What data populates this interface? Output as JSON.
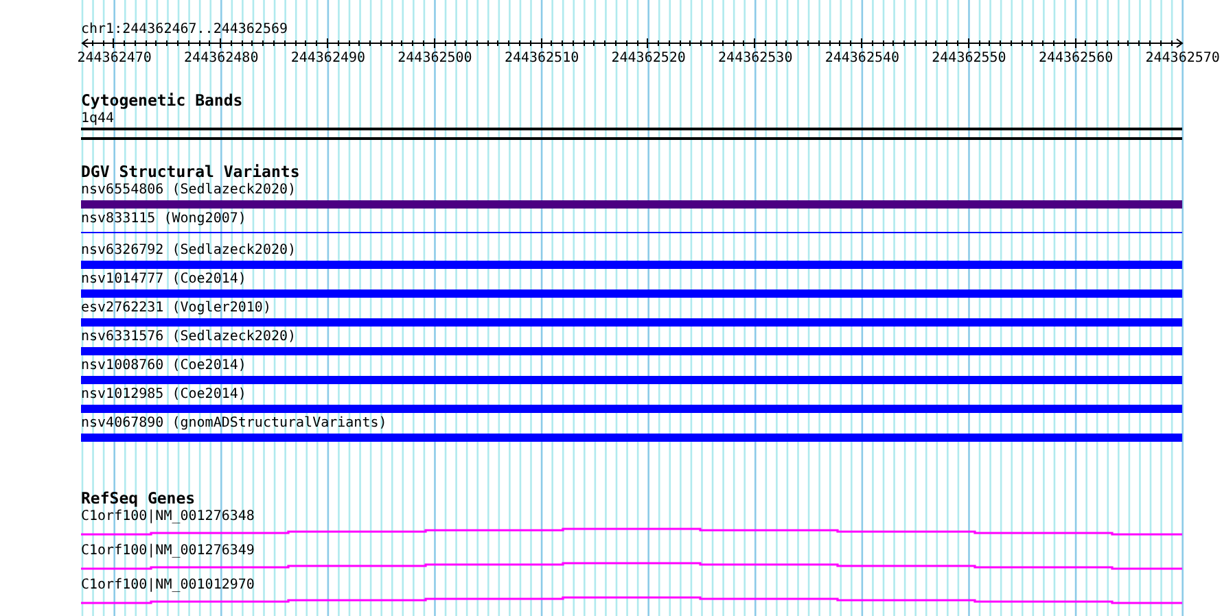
{
  "ruler": {
    "title": "chr1:244362467..244362569",
    "labels": [
      "244362470",
      "244362480",
      "244362490",
      "244362500",
      "244362510",
      "244362520",
      "244362530",
      "244362540",
      "244362550",
      "244362560",
      "244362570"
    ]
  },
  "tracks": [
    {
      "kind": "bands",
      "title": "Cytogenetic Bands",
      "features": [
        {
          "label": "1q44"
        }
      ]
    },
    {
      "kind": "variants",
      "title": "DGV Structural Variants",
      "features": [
        {
          "label": "nsv6554806 (Sedlazeck2020)",
          "kind": "thick",
          "color": "#4b0082"
        },
        {
          "label": "nsv833115 (Wong2007)",
          "kind": "thin",
          "color": "#0000ff"
        },
        {
          "label": "nsv6326792 (Sedlazeck2020)",
          "kind": "thick",
          "color": "#0000ff"
        },
        {
          "label": "nsv1014777 (Coe2014)",
          "kind": "thick",
          "color": "#0000ff"
        },
        {
          "label": "esv2762231 (Vogler2010)",
          "kind": "thick",
          "color": "#0000ff"
        },
        {
          "label": "nsv6331576 (Sedlazeck2020)",
          "kind": "thick",
          "color": "#0000ff"
        },
        {
          "label": "nsv1008760 (Coe2014)",
          "kind": "thick",
          "color": "#0000ff"
        },
        {
          "label": "nsv1012985 (Coe2014)",
          "kind": "thick",
          "color": "#0000ff"
        },
        {
          "label": "nsv4067890 (gnomADStructuralVariants)",
          "kind": "thick",
          "color": "#0000ff"
        }
      ]
    },
    {
      "kind": "genes",
      "title": "RefSeq Genes",
      "features": [
        {
          "label": "C1orf100|NM_001276348"
        },
        {
          "label": "C1orf100|NM_001276349"
        },
        {
          "label": "C1orf100|NM_001012970"
        }
      ]
    }
  ]
}
